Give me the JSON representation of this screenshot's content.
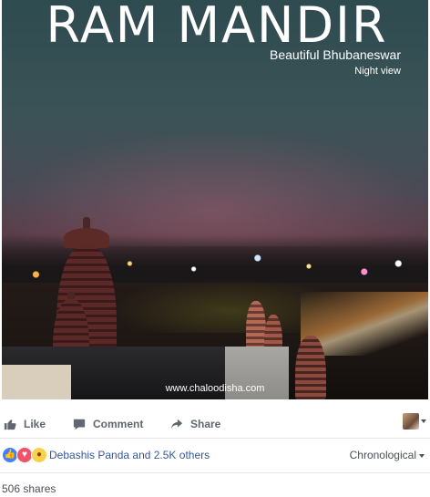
{
  "photo": {
    "title": "RAM MANDIR",
    "subtitle": "Beautiful Bhubaneswar",
    "caption": "Night view",
    "watermark": "www.chaloodisha.com"
  },
  "actions": {
    "like_label": "Like",
    "comment_label": "Comment",
    "share_label": "Share"
  },
  "reactions": {
    "icons": [
      "like-icon",
      "love-icon",
      "wow-icon"
    ],
    "summary": "Debashis Panda and 2.5K others",
    "sort_label": "Chronological"
  },
  "shares": {
    "count_text": "506 shares"
  },
  "colors": {
    "link_blue": "#365899",
    "action_gray": "#606770",
    "like_blue": "#4080ff",
    "love_red": "#f25268",
    "wow_yellow": "#fbd14b"
  }
}
